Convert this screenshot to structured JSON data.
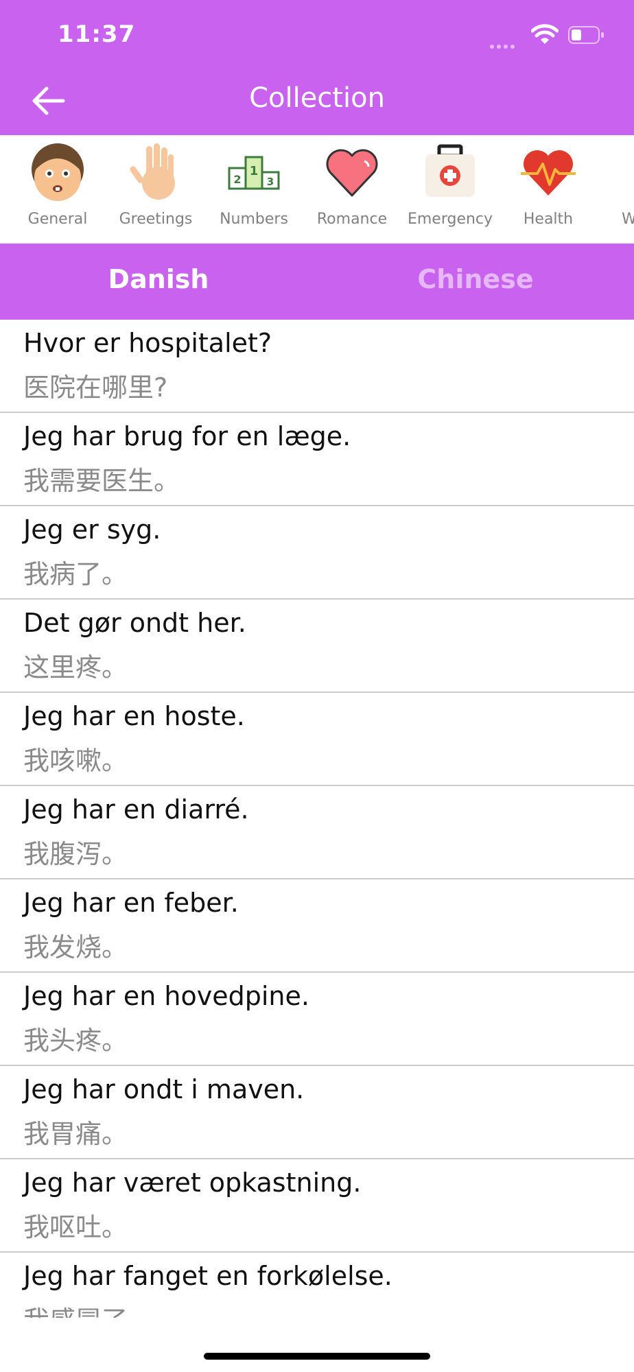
{
  "status": {
    "time": "11:37"
  },
  "header": {
    "title": "Collection"
  },
  "categories": [
    {
      "label": "General",
      "icon": "face-icon"
    },
    {
      "label": "Greetings",
      "icon": "hand-icon"
    },
    {
      "label": "Numbers",
      "icon": "podium-icon"
    },
    {
      "label": "Romance",
      "icon": "heart-icon"
    },
    {
      "label": "Emergency",
      "icon": "first-aid-kit-icon"
    },
    {
      "label": "Health",
      "icon": "heartbeat-icon"
    },
    {
      "label": "We",
      "icon": "weather-icon"
    }
  ],
  "tabs": {
    "source": "Danish",
    "target": "Chinese"
  },
  "phrases": [
    {
      "da": "Hvor er hospitalet?",
      "zh": "医院在哪里?"
    },
    {
      "da": "Jeg har brug for en læge.",
      "zh": "我需要医生。"
    },
    {
      "da": "Jeg er syg.",
      "zh": "我病了。"
    },
    {
      "da": "Det gør ondt her.",
      "zh": "这里疼。"
    },
    {
      "da": "Jeg har en hoste.",
      "zh": "我咳嗽。"
    },
    {
      "da": "Jeg har en diarré.",
      "zh": "我腹泻。"
    },
    {
      "da": "Jeg har en feber.",
      "zh": "我发烧。"
    },
    {
      "da": "Jeg har en hovedpine.",
      "zh": "我头疼。"
    },
    {
      "da": "Jeg har ondt i maven.",
      "zh": "我胃痛。"
    },
    {
      "da": "Jeg har været opkastning.",
      "zh": "我呕吐。"
    },
    {
      "da": "Jeg har fanget en forkølelse.",
      "zh": "我感冒了。"
    }
  ],
  "colors": {
    "accent": "#c862ef",
    "tab_inactive": "#e6b8f8",
    "secondary_text": "#8a8a8a"
  }
}
